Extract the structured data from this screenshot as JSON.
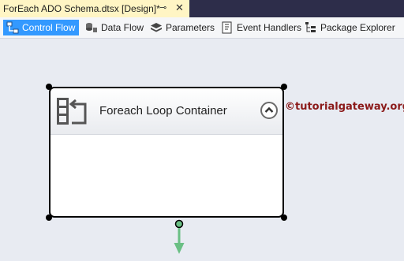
{
  "document_tab": {
    "title": "ForEach ADO Schema.dtsx [Design]*",
    "pin_glyph": "⊸",
    "close_glyph": "✕"
  },
  "toolbar": {
    "items": [
      {
        "label": "Control Flow",
        "icon": "control-flow-icon",
        "active": true
      },
      {
        "label": "Data Flow",
        "icon": "data-flow-icon",
        "active": false
      },
      {
        "label": "Parameters",
        "icon": "parameters-icon",
        "active": false
      },
      {
        "label": "Event Handlers",
        "icon": "event-handlers-icon",
        "active": false
      },
      {
        "label": "Package Explorer",
        "icon": "package-explorer-icon",
        "active": false
      }
    ]
  },
  "container": {
    "title": "Foreach Loop Container",
    "icon": "foreach-loop-icon",
    "collapse_icon": "chevron-up-icon"
  },
  "watermark": {
    "text": "©tutorialgateway.org",
    "color": "#8b1a1a"
  },
  "colors": {
    "tab_active": "#fff5c4",
    "toolbar_active": "#3399ff",
    "connector": "#6abf84",
    "canvas": "#e8ebf2"
  }
}
